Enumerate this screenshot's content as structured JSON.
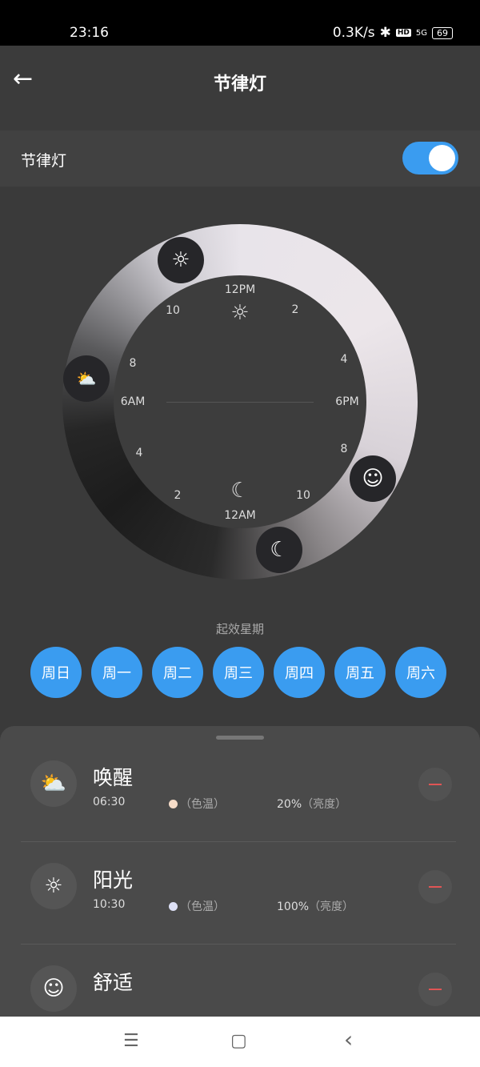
{
  "status": {
    "time": "23:16",
    "speed": "0.3K/s",
    "bluetooth": "✱",
    "hd": "HD",
    "network": "5G",
    "battery": "69"
  },
  "header": {
    "title": "节律灯",
    "back_icon": "arrow-left-icon"
  },
  "toggle": {
    "label": "节律灯",
    "on": true
  },
  "clock": {
    "ticks": [
      "12PM",
      "2",
      "4",
      "6PM",
      "8",
      "10",
      "12AM",
      "2",
      "4",
      "6AM",
      "8",
      "10"
    ]
  },
  "week": {
    "label": "起效星期",
    "days": [
      "周日",
      "周一",
      "周二",
      "周三",
      "周四",
      "周五",
      "周六"
    ]
  },
  "colors": {
    "accent": "#3a9cf0",
    "remove": "#e05555"
  },
  "scenes": [
    {
      "name": "唤醒",
      "time": "06:30",
      "color_label": "（色温）",
      "color": "#f6dcc8",
      "brightness": "20%",
      "brightness_label": "（亮度）",
      "icon": "sunrise-icon"
    },
    {
      "name": "阳光",
      "time": "10:30",
      "color_label": "（色温）",
      "color": "#dde0f6",
      "brightness": "100%",
      "brightness_label": "（亮度）",
      "icon": "sun-icon"
    },
    {
      "name": "舒适",
      "icon": "smile-icon"
    }
  ],
  "nav": {
    "menu": "☰",
    "home": "▢",
    "back": "‹"
  }
}
